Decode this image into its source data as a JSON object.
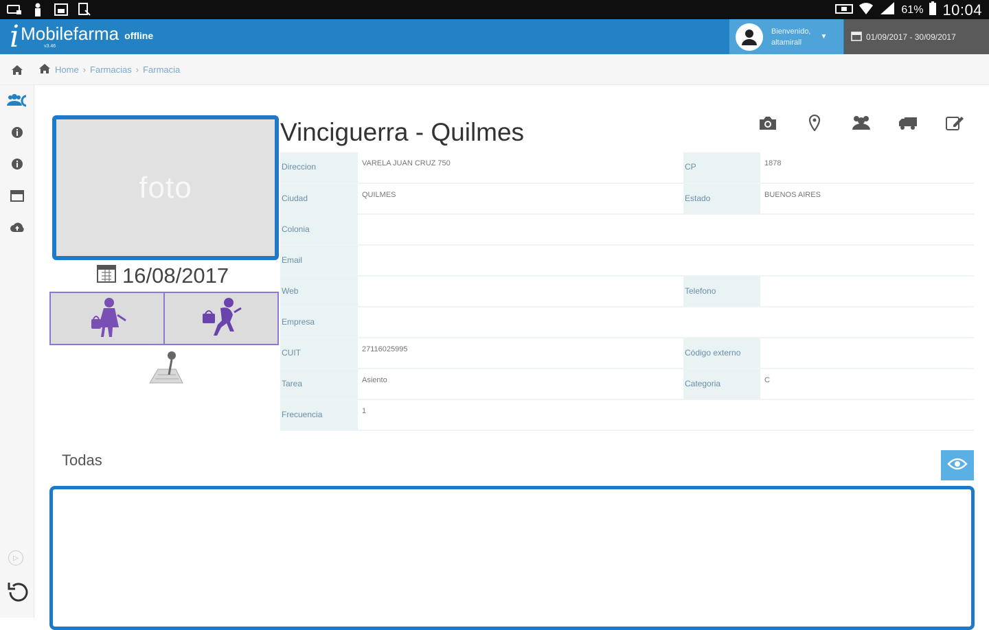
{
  "statusbar": {
    "battery": "61%",
    "time": "10:04"
  },
  "app": {
    "brand": "Mobilefarma",
    "mode": "offline",
    "version": "v3.46"
  },
  "user": {
    "greeting": "Bienvenido,",
    "name": "altamirall"
  },
  "period": {
    "range": "01/09/2017 - 30/09/2017"
  },
  "breadcrumb": [
    "Home",
    "Farmacias",
    "Farmacia"
  ],
  "photo": {
    "placeholder": "foto"
  },
  "visit": {
    "date": "16/08/2017"
  },
  "pharmacy": {
    "title": "Vinciguerra - Quilmes",
    "fields": {
      "direccion": {
        "label": "Direccion",
        "value": "VARELA JUAN CRUZ 750"
      },
      "cp": {
        "label": "CP",
        "value": "1878"
      },
      "ciudad": {
        "label": "Ciudad",
        "value": "QUILMES"
      },
      "estado": {
        "label": "Estado",
        "value": "BUENOS AIRES"
      },
      "colonia": {
        "label": "Colonia",
        "value": ""
      },
      "email": {
        "label": "Email",
        "value": ""
      },
      "web": {
        "label": "Web",
        "value": ""
      },
      "telefono": {
        "label": "Telefono",
        "value": ""
      },
      "empresa": {
        "label": "Empresa",
        "value": ""
      },
      "cuit": {
        "label": "CUIT",
        "value": "27116025995"
      },
      "codigo": {
        "label": "Código externo",
        "value": ""
      },
      "tarea": {
        "label": "Tarea",
        "value": "Asiento"
      },
      "categoria": {
        "label": "Categoria",
        "value": "C"
      },
      "frecuencia": {
        "label": "Frecuencia",
        "value": "1"
      }
    }
  },
  "notes": {
    "filter_label": "Todas"
  },
  "colors": {
    "primary": "#2382c3",
    "accent_border": "#1f78c8",
    "user_bg": "#4ea3d8",
    "date_bg": "#5a5a5a",
    "avatar_purple": "#7a4fb5"
  }
}
